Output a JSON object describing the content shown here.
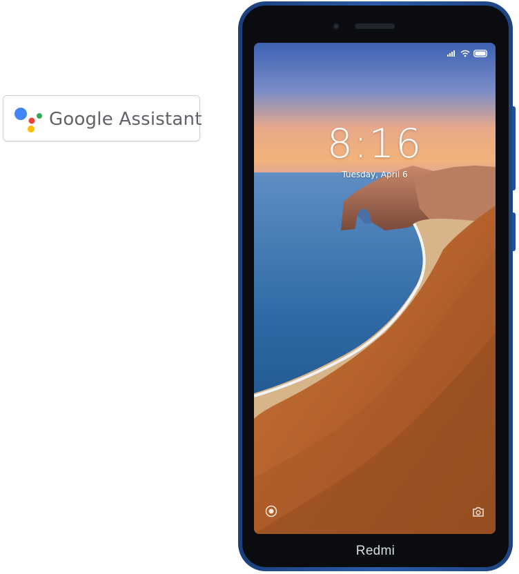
{
  "badge": {
    "label": "Google Assistant",
    "icon": "google-assistant-dots-icon",
    "dot_colors": [
      "#4285F4",
      "#EA4335",
      "#FBBC05",
      "#34A853"
    ]
  },
  "phone": {
    "brand": "Redmi",
    "body_color": "#2c5aa8",
    "lockscreen": {
      "time": "8:16",
      "date": "Tuesday, April 6",
      "status_icons": [
        "signal-icon",
        "wifi-icon",
        "battery-icon"
      ],
      "left_shortcut_icon": "assistant-icon",
      "right_shortcut_icon": "camera-icon"
    }
  }
}
